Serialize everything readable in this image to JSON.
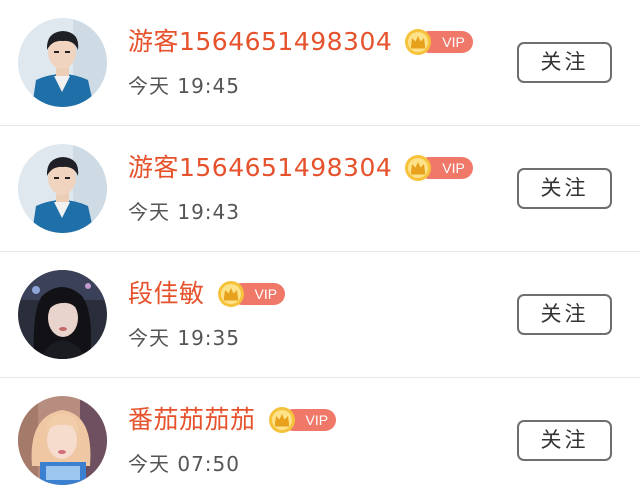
{
  "users": [
    {
      "name": "游客1564651498304",
      "vip_label": "VIP",
      "time": "今天 19:45",
      "follow_label": "关注",
      "avatar_icon": "avatar-boy-blue-jacket"
    },
    {
      "name": "游客1564651498304",
      "vip_label": "VIP",
      "time": "今天 19:43",
      "follow_label": "关注",
      "avatar_icon": "avatar-boy-blue-jacket"
    },
    {
      "name": "段佳敏",
      "vip_label": "VIP",
      "time": "今天 19:35",
      "follow_label": "关注",
      "avatar_icon": "avatar-girl-dark"
    },
    {
      "name": "番茄茄茄茄",
      "vip_label": "VIP",
      "time": "今天 07:50",
      "follow_label": "关注",
      "avatar_icon": "avatar-girl-pink-hair"
    }
  ],
  "colors": {
    "name": "#e6522c",
    "vip_badge": "#f07868",
    "crown": "#f5c23a",
    "button_border": "#6e6e6e",
    "divider": "#e7e7e7"
  }
}
